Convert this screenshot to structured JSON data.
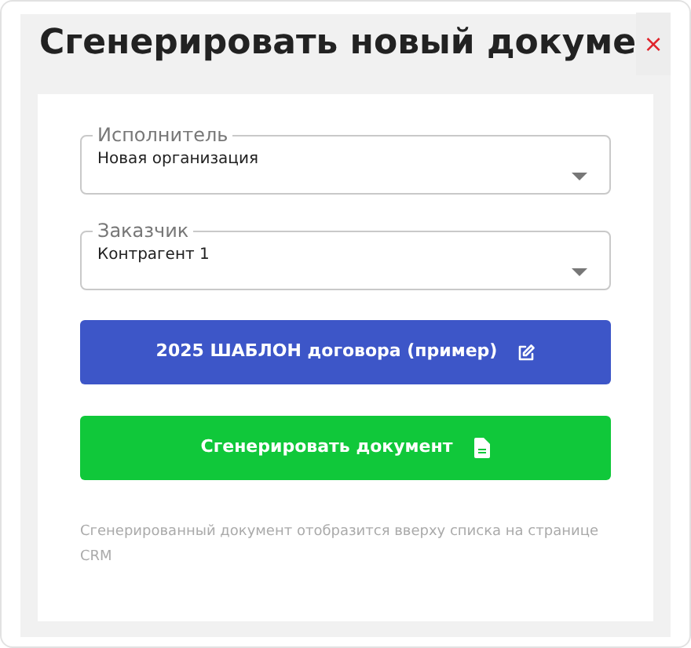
{
  "dialog": {
    "title": "Сгенерировать новый докуме",
    "close": "×"
  },
  "fields": [
    {
      "label": "Исполнитель",
      "value": "Новая организация"
    },
    {
      "label": "Заказчик",
      "value": "Контрагент 1"
    }
  ],
  "template_button": {
    "label": "2025 ШАБЛОН договора (пример)"
  },
  "generate_button": {
    "label": "Сгенерировать документ"
  },
  "note": "Сгенерированный документ отобразится вверху списка на странице CRM"
}
